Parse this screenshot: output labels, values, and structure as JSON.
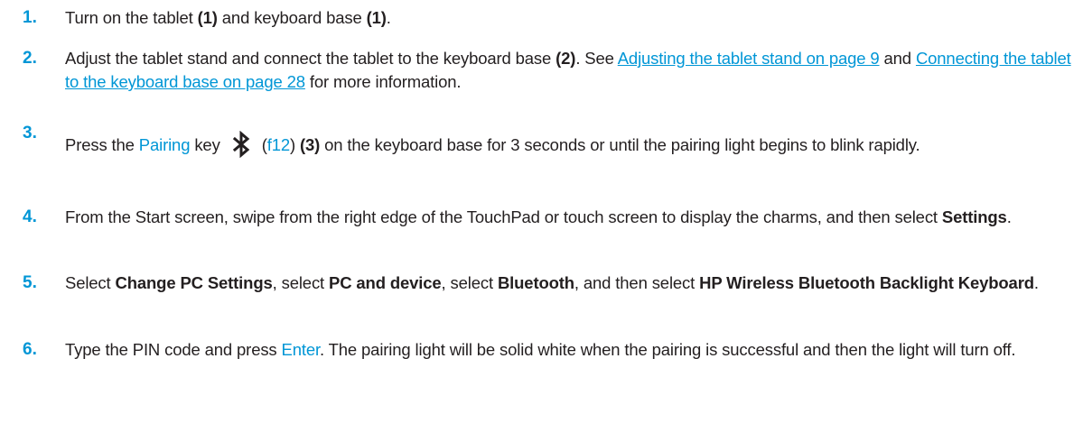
{
  "steps": [
    {
      "num": "1.",
      "t1": "Turn on the tablet ",
      "b1": "(1)",
      "t2": " and keyboard base ",
      "b2": "(1)",
      "t3": "."
    },
    {
      "num": "2.",
      "t1": "Adjust the tablet stand and connect the tablet to the keyboard base ",
      "b1": "(2)",
      "t2": ". See ",
      "link1": "Adjusting the tablet stand on page 9",
      "t3": " and ",
      "link2": "Connecting the tablet to the keyboard base on page 28",
      "t4": " for more information."
    },
    {
      "num": "3.",
      "t1": "Press the ",
      "kw1": "Pairing",
      "t2": " key",
      "icon": "bluetooth-icon",
      "t3": "(",
      "kw2": "f12",
      "t4": ") ",
      "b1": "(3)",
      "t5": " on the keyboard base for 3 seconds or until the pairing light begins to blink rapidly."
    },
    {
      "num": "4.",
      "t1": "From the Start screen, swipe from the right edge of the TouchPad or touch screen to display the charms, and then select ",
      "b1": "Settings",
      "t2": "."
    },
    {
      "num": "5.",
      "t1": "Select ",
      "b1": "Change PC Settings",
      "t2": ", select ",
      "b2": "PC and device",
      "t3": ", select ",
      "b3": "Bluetooth",
      "t4": ", and then select ",
      "b4": "HP Wireless Bluetooth Backlight Keyboard",
      "t5": "."
    },
    {
      "num": "6.",
      "t1": "Type the PIN code and press ",
      "kw1": "Enter",
      "t2": ". The pairing light will be solid white when the pairing is successful and then the light will turn off."
    }
  ],
  "colors": {
    "accent": "#0096d6",
    "text": "#231f20"
  }
}
